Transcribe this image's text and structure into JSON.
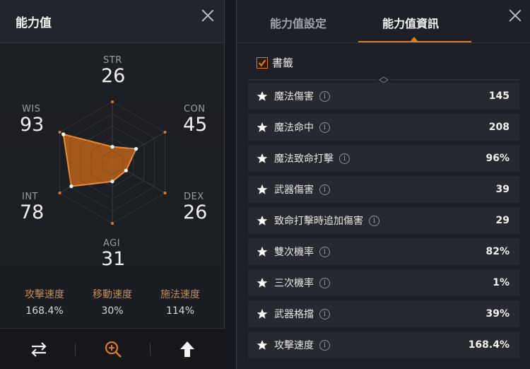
{
  "left_panel": {
    "title": "能力值",
    "stats": {
      "str": {
        "label": "STR",
        "value": "26"
      },
      "con": {
        "label": "CON",
        "value": "45"
      },
      "dex": {
        "label": "DEX",
        "value": "26"
      },
      "agi": {
        "label": "AGI",
        "value": "31"
      },
      "int": {
        "label": "INT",
        "value": "78"
      },
      "wis": {
        "label": "WIS",
        "value": "93"
      }
    },
    "speeds": [
      {
        "label": "攻擊速度",
        "value": "168.4%"
      },
      {
        "label": "移動速度",
        "value": "30%"
      },
      {
        "label": "施法速度",
        "value": "114%"
      }
    ],
    "bottom_icons": [
      "swap-arrows-icon",
      "zoom-in-icon",
      "upload-arrow-icon"
    ],
    "accent_color": "#e07a22"
  },
  "right_panel": {
    "tabs": [
      {
        "label": "能力值設定",
        "active": false
      },
      {
        "label": "能力值資訊",
        "active": true
      }
    ],
    "bookmark": {
      "label": "書籤",
      "checked": true
    },
    "rows": [
      {
        "name": "魔法傷害",
        "value": "145"
      },
      {
        "name": "魔法命中",
        "value": "208"
      },
      {
        "name": "魔法致命打擊",
        "value": "96%"
      },
      {
        "name": "武器傷害",
        "value": "39"
      },
      {
        "name": "致命打擊時追加傷害",
        "value": "29"
      },
      {
        "name": "雙次機率",
        "value": "82%"
      },
      {
        "name": "三次機率",
        "value": "1%"
      },
      {
        "name": "武器格擋",
        "value": "39%"
      },
      {
        "name": "攻擊速度",
        "value": "168.4%"
      }
    ],
    "info_glyph": "i"
  }
}
